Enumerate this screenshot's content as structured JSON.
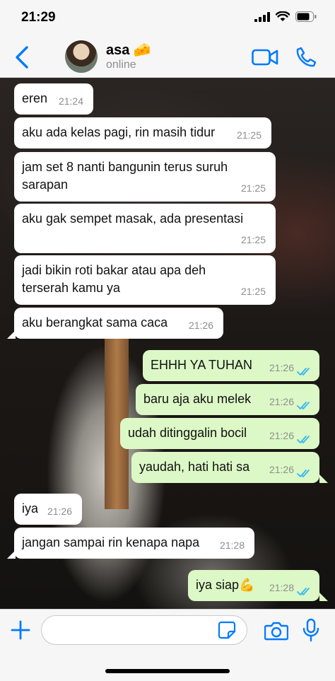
{
  "status_bar": {
    "time": "21:29"
  },
  "header": {
    "contact_name": "asa 🧀",
    "contact_status": "online"
  },
  "messages": [
    {
      "dir": "in",
      "lines": [
        "eren"
      ],
      "time": "21:24"
    },
    {
      "dir": "in",
      "lines": [
        "aku ada kelas pagi, rin masih tidur"
      ],
      "time": "21:25"
    },
    {
      "dir": "in",
      "lines": [
        "jam set 8 nanti bangunin terus suruh",
        "sarapan"
      ],
      "time": "21:25"
    },
    {
      "dir": "in",
      "lines": [
        "aku gak sempet masak, ada presentasi"
      ],
      "time": "21:25"
    },
    {
      "dir": "in",
      "lines": [
        "jadi bikin roti bakar atau apa deh",
        "terserah kamu ya"
      ],
      "time": "21:25"
    },
    {
      "dir": "in",
      "lines": [
        "aku berangkat sama caca"
      ],
      "time": "21:26"
    },
    {
      "dir": "out",
      "lines": [
        "EHHH YA TUHAN"
      ],
      "time": "21:26"
    },
    {
      "dir": "out",
      "lines": [
        "baru aja aku melek"
      ],
      "time": "21:26"
    },
    {
      "dir": "out",
      "lines": [
        "udah ditinggalin bocil"
      ],
      "time": "21:26"
    },
    {
      "dir": "out",
      "lines": [
        "yaudah, hati hati sa"
      ],
      "time": "21:26"
    },
    {
      "dir": "in",
      "lines": [
        "iya"
      ],
      "time": "21:26"
    },
    {
      "dir": "in",
      "lines": [
        "jangan sampai rin kenapa napa"
      ],
      "time": "21:28"
    },
    {
      "dir": "out",
      "lines": [
        "iya siap💪"
      ],
      "time": "21:28"
    }
  ],
  "input": {
    "placeholder": ""
  },
  "colors": {
    "accent": "#007aff",
    "incoming_bubble": "#ffffff",
    "outgoing_bubble": "#dcf8c6",
    "read_ticks": "#34b7f1"
  },
  "icons": {
    "back": "chevron-left-icon",
    "video": "video-camera-icon",
    "phone": "phone-icon",
    "plus": "plus-icon",
    "sticker": "sticker-icon",
    "camera": "camera-icon",
    "mic": "microphone-icon",
    "ticks": "double-check-icon"
  }
}
